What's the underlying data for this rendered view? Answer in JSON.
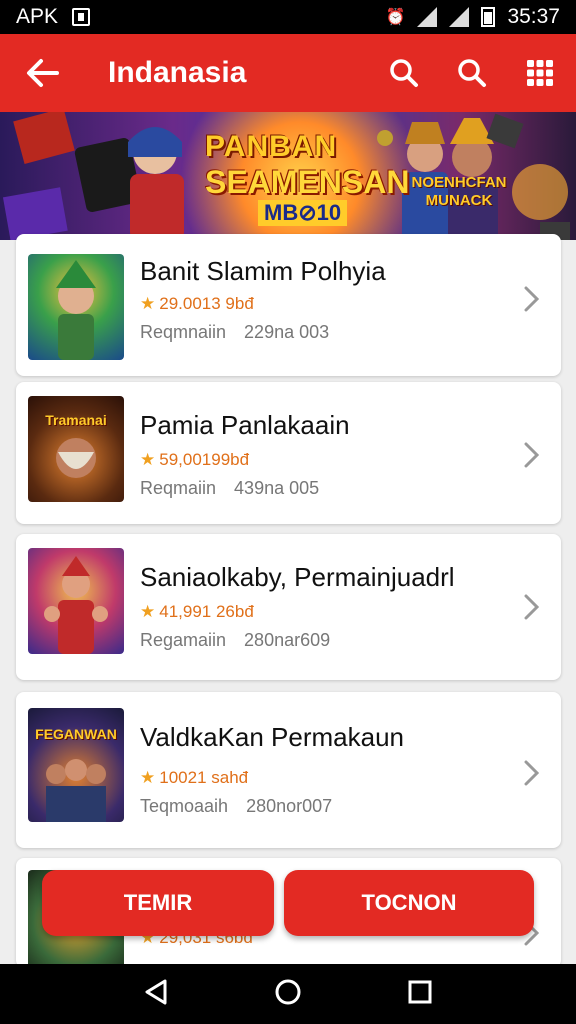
{
  "status_bar": {
    "carrier_label": "APK",
    "time": "35:37",
    "icons": [
      "notification-icon",
      "alarm-icon",
      "vibrate-icon",
      "wifi-icon",
      "signal-icon",
      "battery-icon"
    ]
  },
  "app_bar": {
    "title": "Indanasia",
    "icons": [
      "back-arrow-icon",
      "search-icon",
      "search-icon",
      "grid-icon"
    ]
  },
  "banner": {
    "line1": "PANBAN",
    "line2": "SEAMENSAN",
    "line3": "MB⊘10",
    "side_tag": "NOENHCFAN MUNACK"
  },
  "games": [
    {
      "name": "Banit Slamim Polhyia",
      "rating": "29.0013 9bđ",
      "meta1": "Reqmnaiin",
      "meta2": "229na 003"
    },
    {
      "name": "Pamia Panlakaain",
      "rating": "59,00199bđ",
      "meta1": "Reqmaiin",
      "meta2": "439na 005",
      "thumb_label": "Tramanai"
    },
    {
      "name": "Saniaolkaby, Permainjuadrl",
      "rating": "41,991 26bđ",
      "meta1": "Regamaiin",
      "meta2": "280nar609"
    },
    {
      "name": "ValdkaKan Permakaun",
      "rating": "10021 sahđ",
      "meta1": "Teqmoaaih",
      "meta2": "280nor007",
      "thumb_label": "FEGANWAN"
    },
    {
      "name": "",
      "rating": "29,031 s6bđ",
      "meta1": "",
      "meta2": ""
    }
  ],
  "buttons": {
    "left": "TEMIR",
    "right": "TOCNON"
  },
  "nav": {
    "icons": [
      "back-triangle-icon",
      "home-circle-icon",
      "recents-square-icon"
    ]
  },
  "colors": {
    "primary_red": "#e32a23",
    "rating_orange": "#e0701a",
    "star_gold": "#f0a020"
  }
}
